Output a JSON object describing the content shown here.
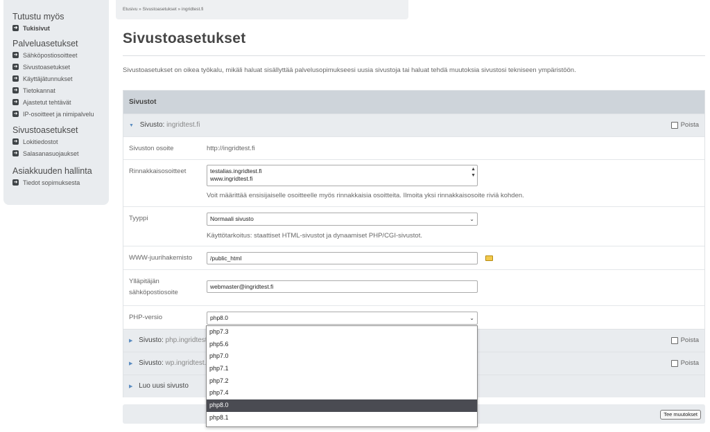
{
  "sidebar": {
    "groups": [
      {
        "title": "Tutustu myös",
        "items": [
          {
            "label": "Tukisivut"
          }
        ]
      },
      {
        "title": "Palveluasetukset",
        "items": [
          {
            "label": "Sähköpostiosoitteet"
          },
          {
            "label": "Sivustoasetukset"
          },
          {
            "label": "Käyttäjätunnukset"
          },
          {
            "label": "Tietokannat"
          },
          {
            "label": "Ajastetut tehtävät"
          },
          {
            "label": "IP-osoitteet ja nimipalvelu"
          }
        ]
      },
      {
        "title": "Sivustoasetukset",
        "items": [
          {
            "label": "Lokitiedostot"
          },
          {
            "label": "Salasanasuojaukset"
          }
        ]
      },
      {
        "title": "Asiakkuuden hallinta",
        "items": [
          {
            "label": "Tiedot sopimuksesta"
          }
        ]
      }
    ]
  },
  "breadcrumb": "Etusivu » Sivustoasetukset » ingridtest.fi",
  "page": {
    "title": "Sivustoasetukset",
    "intro": "Sivustoasetukset on oikea työkalu, mikäli haluat sisällyttää palvelusopimukseesi uusia sivustoja tai haluat tehdä muutoksia sivustosi tekniseen ympäristöön."
  },
  "panel": {
    "header": "Sivustot",
    "site": {
      "label": "Sivusto:",
      "name": "ingridtest.fi",
      "delete": "Poista"
    },
    "fields": {
      "address_label": "Sivuston osoite",
      "address_value": "http://ingridtest.fi",
      "aliases_label": "Rinnakkaisosoitteet",
      "aliases_line1": "testalias.ingridtest.fi",
      "aliases_line2": "www.ingridtest.fi",
      "aliases_help": "Voit määrittää ensisijaiselle osoitteelle myös rinnakkaisia osoitteita. Ilmoita yksi rinnakkaisosoite riviä kohden.",
      "type_label": "Tyyppi",
      "type_value": "Normaali sivusto",
      "type_help": "Käyttötarkoitus: staattiset HTML-sivustot ja dynaamiset PHP/CGI-sivustot.",
      "root_label": "WWW-juurihakemisto",
      "root_value": "/public_html",
      "admin_email_label_1": "Ylläpitäjän",
      "admin_email_label_2": "sähköpostiosoite",
      "admin_email_value": "webmaster@ingridtest.fi",
      "php_label": "PHP-versio",
      "php_value": "php8.0"
    },
    "other_sites": [
      {
        "label": "Sivusto:",
        "name": "php.ingridtest.fi",
        "delete": "Poista"
      },
      {
        "label": "Sivusto:",
        "name": "wp.ingridtest.fi",
        "delete": "Poista"
      }
    ],
    "new_site": "Luo uusi sivusto"
  },
  "php_options": [
    "php7.3",
    "php5.6",
    "php7.0",
    "php7.1",
    "php7.2",
    "php7.4",
    "php8.0",
    "php8.1"
  ],
  "php_selected_index": 6,
  "save_button": "Tee muutokset"
}
